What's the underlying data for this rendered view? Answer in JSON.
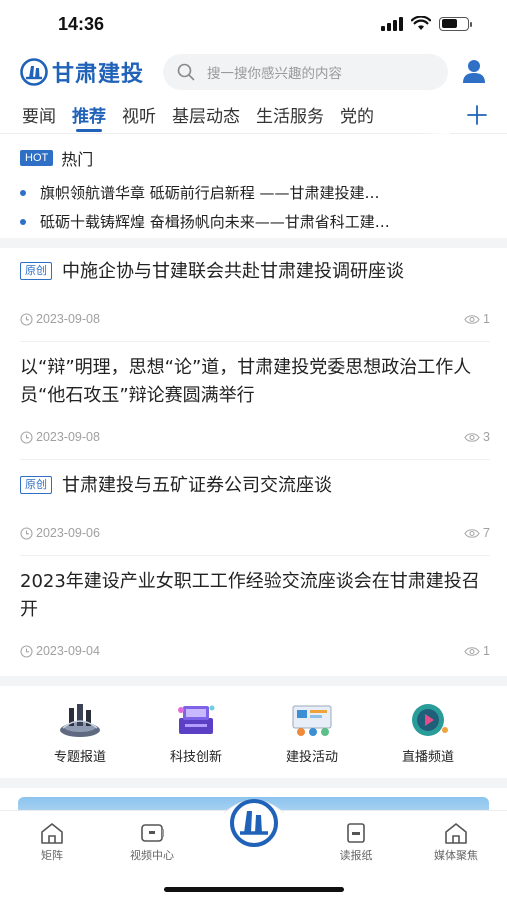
{
  "status_bar": {
    "time": "14:36"
  },
  "header": {
    "brand": "甘肃建投",
    "search_placeholder": "搜一搜你感兴趣的内容"
  },
  "tabs": [
    {
      "label": "要闻",
      "active": false
    },
    {
      "label": "推荐",
      "active": true
    },
    {
      "label": "视听",
      "active": false
    },
    {
      "label": "基层动态",
      "active": false
    },
    {
      "label": "生活服务",
      "active": false
    },
    {
      "label": "党的",
      "active": false
    }
  ],
  "hot": {
    "badge": "HOT",
    "title": "热门",
    "items": [
      "旗帜领航谱华章  砥砺前行启新程  ——甘肃建投建…",
      "砥砺十载铸辉煌  奋楫扬帆向未来——甘肃省科工建…"
    ]
  },
  "articles": [
    {
      "badge": "原创",
      "title": "中施企协与甘建联会共赴甘肃建投调研座谈",
      "date": "2023-09-08",
      "views": "1"
    },
    {
      "badge": "",
      "title": "以“辩”明理，思想“论”道，甘肃建投党委思想政治工作人员“他石攻玉”辩论赛圆满举行",
      "date": "2023-09-08",
      "views": "3"
    },
    {
      "badge": "原创",
      "title": "甘肃建投与五矿证券公司交流座谈",
      "date": "2023-09-06",
      "views": "7"
    },
    {
      "badge": "",
      "title": "2023年建设产业女职工工作经验交流座谈会在甘肃建投召开",
      "date": "2023-09-04",
      "views": "1"
    }
  ],
  "quick_entries": [
    {
      "label": "专题报道",
      "icon": "topic-report-icon"
    },
    {
      "label": "科技创新",
      "icon": "tech-innovation-icon"
    },
    {
      "label": "建投活动",
      "icon": "activity-icon"
    },
    {
      "label": "直播频道",
      "icon": "live-channel-icon"
    }
  ],
  "bottom_nav": [
    {
      "label": "矩阵",
      "icon": "matrix-icon"
    },
    {
      "label": "视频中心",
      "icon": "video-center-icon"
    },
    {
      "label": "读报纸",
      "icon": "newspaper-icon"
    },
    {
      "label": "媒体聚焦",
      "icon": "media-focus-icon"
    }
  ],
  "colors": {
    "brand": "#1f62b8",
    "accent": "#2f6fc6"
  }
}
